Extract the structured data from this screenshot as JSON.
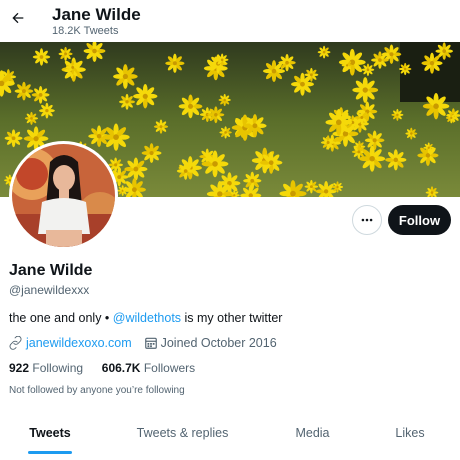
{
  "header": {
    "back_icon": "arrow-left-icon",
    "name": "Jane Wilde",
    "tweet_count": "18.2K Tweets"
  },
  "banner": {
    "description_icon": "yellow-flowers-photo"
  },
  "actions": {
    "more_icon": "ellipsis-icon",
    "follow_label": "Follow"
  },
  "profile": {
    "display_name": "Jane Wilde",
    "handle": "@janewildexxx",
    "bio_prefix": "the one and only • ",
    "bio_mention": "@wildethots",
    "bio_suffix": " is my other twitter",
    "website": "janewildexoxo.com",
    "joined": "Joined October 2016",
    "following_count": "922",
    "following_label": "Following",
    "followers_count": "606.7K",
    "followers_label": "Followers",
    "not_followed": "Not followed by anyone you’re following"
  },
  "tabs": [
    {
      "label": "Tweets",
      "active": true
    },
    {
      "label": "Tweets & replies",
      "active": false
    },
    {
      "label": "Media",
      "active": false
    },
    {
      "label": "Likes",
      "active": false
    }
  ],
  "colors": {
    "accent": "#1d9bf0",
    "text_primary": "#0f1419",
    "text_secondary": "#536471",
    "follow_button_bg": "#0f1419"
  }
}
